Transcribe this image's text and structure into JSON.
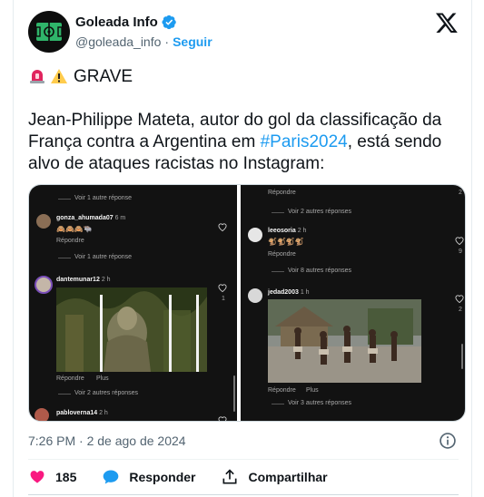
{
  "tweet": {
    "display_name": "Goleada Info",
    "handle": "@goleada_info",
    "separator": "·",
    "follow_label": "Seguir",
    "line1": "GRAVE",
    "body_before": "Jean-Philippe Mateta, autor do gol da classificação da França contra a Argentina em ",
    "hashtag": "#Paris2024",
    "body_after": ", está sendo alvo de ataques racistas no Instagram:",
    "timestamp": "7:26 PM · 2 de ago de 2024"
  },
  "actions": {
    "likes": "185",
    "reply_label": "Responder",
    "share_label": "Compartilhar"
  },
  "media": {
    "left": {
      "top_link": "Voir 1 autre réponse",
      "c1_user": "gonza_ahumada07",
      "c1_time": "6 m",
      "c1_text": "🙈🙈🙈🐃",
      "c1_reply": "Répondre",
      "mid_link": "Voir 1 autre réponse",
      "c2_user": "dantemunar12",
      "c2_time": "2 h",
      "c2_count": "1",
      "c2_reply": "Répondre",
      "c2_plus": "Plus",
      "link3": "Voir 2 autres réponses",
      "c3_user": "pabloverna14",
      "c3_time": "2 h"
    },
    "right": {
      "top_reply": "Répondre",
      "top_count": "2",
      "top_link": "Voir 2 autres réponses",
      "c1_user": "leeosoria",
      "c1_time": "2 h",
      "c1_text": "🐒🐒🐒🐒",
      "c1_count": "9",
      "c1_reply": "Répondre",
      "link2": "Voir 8 autres réponses",
      "c2_user": "jedad2003",
      "c2_time": "1 h",
      "c2_count": "2",
      "c2_reply": "Répondre",
      "c2_plus": "Plus",
      "link3": "Voir 3 autres réponses"
    }
  },
  "colors": {
    "accent": "#1d9bf0",
    "like": "#f91880",
    "text": "#0f1419",
    "muted": "#536471",
    "ig_bg": "#121212"
  },
  "icons": [
    "verified-badge-icon",
    "x-logo-icon",
    "siren-emoji-icon",
    "warning-emoji-icon",
    "info-icon",
    "heart-icon",
    "reply-bubble-icon",
    "share-icon"
  ]
}
